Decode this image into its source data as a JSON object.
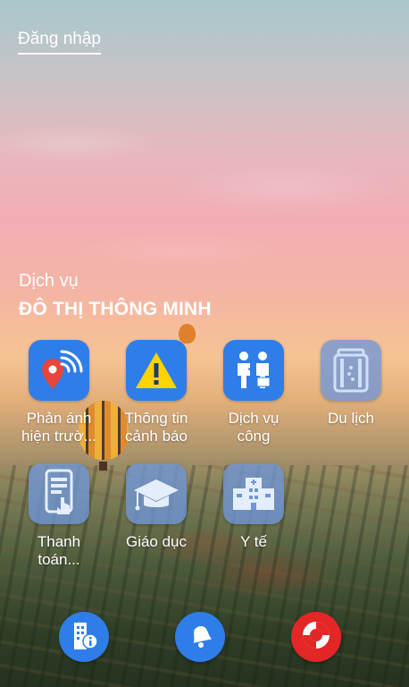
{
  "header": {
    "login_label": "Đăng nhập"
  },
  "section": {
    "subtitle": "Dịch vụ",
    "title": "ĐÔ THỊ THÔNG MINH"
  },
  "services": [
    {
      "line1": "Phản ánh",
      "line2": "hiện trườ...",
      "icon": "location-signal-icon"
    },
    {
      "line1": "Thông tin",
      "line2": "cảnh báo",
      "icon": "warning-icon"
    },
    {
      "line1": "Dịch vụ",
      "line2": "công",
      "icon": "public-service-icon"
    },
    {
      "line1": "Du lịch",
      "line2": "",
      "icon": "luggage-icon"
    },
    {
      "line1": "Thanh",
      "line2": "toán...",
      "icon": "payment-phone-icon"
    },
    {
      "line1": "Giáo dục",
      "line2": "",
      "icon": "graduation-cap-icon"
    },
    {
      "line1": "Y tế",
      "line2": "",
      "icon": "hospital-icon"
    }
  ],
  "bottom_bar": [
    {
      "icon": "building-info-icon"
    },
    {
      "icon": "bell-icon"
    },
    {
      "icon": "lifebuoy-icon"
    }
  ],
  "colors": {
    "accent": "#2f7de8",
    "faded_tile": "#6e96d7",
    "sos": "#e32626"
  }
}
